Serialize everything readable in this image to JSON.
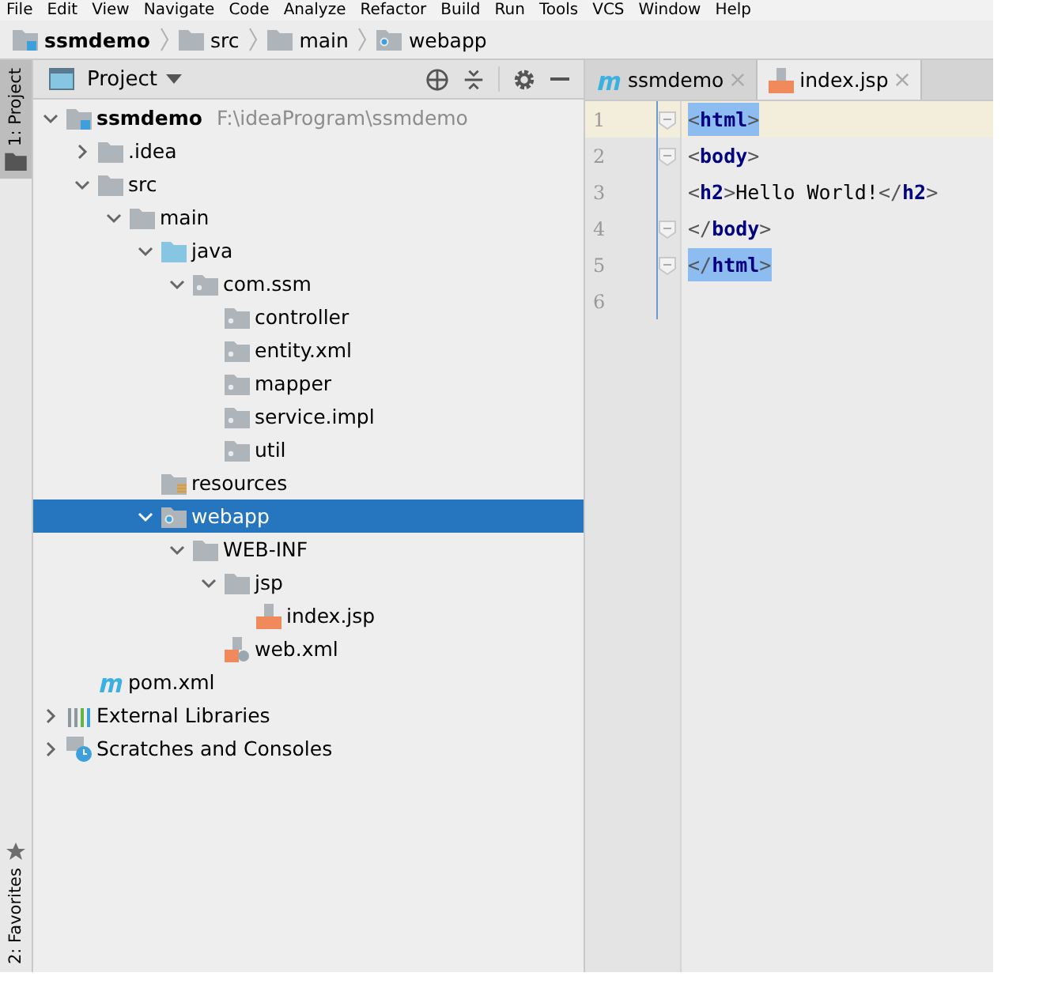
{
  "menu": [
    "File",
    "Edit",
    "View",
    "Navigate",
    "Code",
    "Analyze",
    "Refactor",
    "Build",
    "Run",
    "Tools",
    "VCS",
    "Window",
    "Help"
  ],
  "breadcrumb": [
    {
      "label": "ssmdemo",
      "kind": "project"
    },
    {
      "label": "src",
      "kind": "folder"
    },
    {
      "label": "main",
      "kind": "folder"
    },
    {
      "label": "webapp",
      "kind": "web-folder"
    }
  ],
  "tool_stripe": [
    {
      "label": "1: Project",
      "selected": true,
      "kind": "folder"
    },
    {
      "label": "2: Favorites",
      "selected": false,
      "kind": "star"
    }
  ],
  "project_panel": {
    "title": "Project",
    "tree": [
      {
        "label": "ssmdemo",
        "path": "F:\\ideaProgram\\ssmdemo",
        "kind": "project",
        "expanded": true,
        "selected": false,
        "children": [
          {
            "label": ".idea",
            "kind": "folder",
            "expanded": false,
            "selected": false
          },
          {
            "label": "src",
            "kind": "folder",
            "expanded": true,
            "selected": false,
            "children": [
              {
                "label": "main",
                "kind": "folder",
                "expanded": true,
                "selected": false,
                "children": [
                  {
                    "label": "java",
                    "kind": "source-folder",
                    "expanded": true,
                    "selected": false,
                    "children": [
                      {
                        "label": "com.ssm",
                        "kind": "package",
                        "expanded": true,
                        "selected": false,
                        "children": [
                          {
                            "label": "controller",
                            "kind": "package",
                            "selected": false
                          },
                          {
                            "label": "entity.xml",
                            "kind": "package",
                            "selected": false
                          },
                          {
                            "label": "mapper",
                            "kind": "package",
                            "selected": false
                          },
                          {
                            "label": "service.impl",
                            "kind": "package",
                            "selected": false
                          },
                          {
                            "label": "util",
                            "kind": "package",
                            "selected": false
                          }
                        ]
                      }
                    ]
                  },
                  {
                    "label": "resources",
                    "kind": "resources-folder",
                    "selected": false
                  },
                  {
                    "label": "webapp",
                    "kind": "web-folder",
                    "expanded": true,
                    "selected": true,
                    "children": [
                      {
                        "label": "WEB-INF",
                        "kind": "folder",
                        "expanded": true,
                        "selected": false,
                        "children": [
                          {
                            "label": "jsp",
                            "kind": "folder",
                            "expanded": true,
                            "selected": false,
                            "children": [
                              {
                                "label": "index.jsp",
                                "kind": "jsp-file",
                                "selected": false
                              }
                            ]
                          },
                          {
                            "label": "web.xml",
                            "kind": "xml-file",
                            "selected": false
                          }
                        ]
                      }
                    ]
                  }
                ]
              }
            ]
          },
          {
            "label": "pom.xml",
            "kind": "maven-file",
            "selected": false
          }
        ]
      },
      {
        "label": "External Libraries",
        "kind": "libraries",
        "expanded": false,
        "selected": false
      },
      {
        "label": "Scratches and Consoles",
        "kind": "scratches",
        "expanded": false,
        "selected": false
      }
    ]
  },
  "editor": {
    "tabs": [
      {
        "label": "ssmdemo",
        "kind": "maven-file",
        "selected": false
      },
      {
        "label": "index.jsp",
        "kind": "jsp-file",
        "selected": true
      }
    ],
    "lines": [
      {
        "number": "1",
        "current": true,
        "fold": true,
        "tokens": [
          {
            "kind": "tag",
            "open": "<",
            "name": "html",
            "close": ">",
            "matched": true
          }
        ]
      },
      {
        "number": "2",
        "current": false,
        "fold": true,
        "tokens": [
          {
            "kind": "tag",
            "open": "<",
            "name": "body",
            "close": ">",
            "matched": false
          }
        ]
      },
      {
        "number": "3",
        "current": false,
        "fold": false,
        "tokens": [
          {
            "kind": "tag",
            "open": "<",
            "name": "h2",
            "close": ">",
            "matched": false
          },
          {
            "kind": "text",
            "text": "Hello World!"
          },
          {
            "kind": "tag",
            "open": "</",
            "name": "h2",
            "close": ">",
            "matched": false
          }
        ]
      },
      {
        "number": "4",
        "current": false,
        "fold": true,
        "tokens": [
          {
            "kind": "tag",
            "open": "</",
            "name": "body",
            "close": ">",
            "matched": false
          }
        ]
      },
      {
        "number": "5",
        "current": false,
        "fold": true,
        "tokens": [
          {
            "kind": "tag",
            "open": "</",
            "name": "html",
            "close": ">",
            "matched": true
          }
        ]
      },
      {
        "number": "6",
        "current": false,
        "fold": false
      }
    ]
  }
}
